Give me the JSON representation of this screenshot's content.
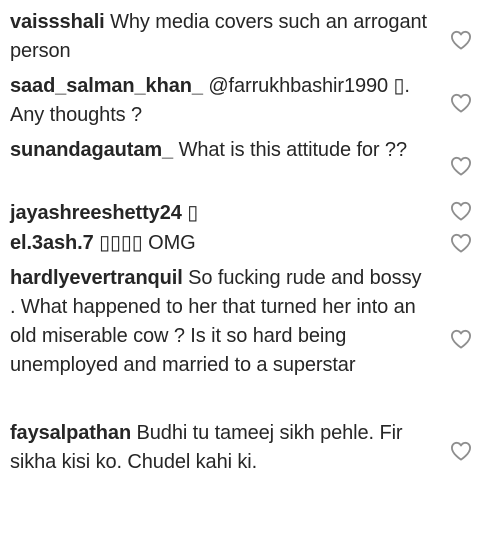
{
  "comments": [
    {
      "username": "vaissshali",
      "text": "Why media covers such an arrogant person",
      "like_icon": "heart-outline-icon"
    },
    {
      "username": "saad_salman_khan_",
      "text": "@farrukhbashir1990 ▯. Any thoughts ?",
      "like_icon": "heart-outline-icon"
    },
    {
      "username": "sunandagautam_",
      "text": "What is this attitude for ??",
      "like_icon": "heart-outline-icon"
    },
    {
      "username": "jayashreeshetty24",
      "text": "▯",
      "like_icon": "heart-outline-icon"
    },
    {
      "username": "el.3ash.7",
      "text": "▯▯▯▯ OMG",
      "like_icon": "heart-outline-icon"
    },
    {
      "username": "hardlyevertranquil",
      "text": "So fucking rude and bossy . What happened to her that turned her into an old miserable cow ? Is it so hard being unemployed and married to a superstar",
      "like_icon": "heart-outline-icon"
    },
    {
      "username": "faysalpathan",
      "text": "Budhi tu tameej sikh pehle. Fir sikha kisi ko. Chudel kahi ki.",
      "like_icon": "heart-outline-icon"
    }
  ],
  "colors": {
    "text": "#262626",
    "icon": "#8e8e8e"
  }
}
